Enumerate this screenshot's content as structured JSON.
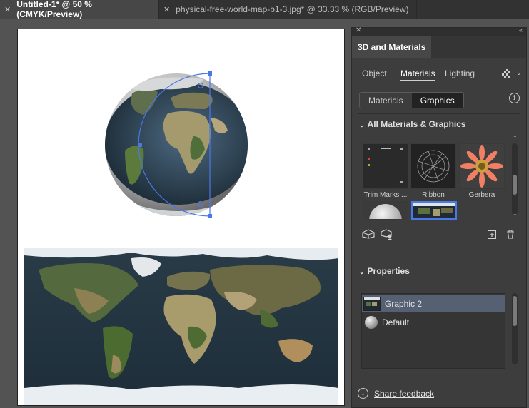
{
  "tabs": [
    {
      "label": "Untitled-1* @ 50 % (CMYK/Preview)",
      "active": true
    },
    {
      "label": "physical-free-world-map-b1-3.jpg* @ 33.33 % (RGB/Preview)",
      "active": false
    }
  ],
  "panel": {
    "title": "3D and Materials",
    "tabs": [
      "Object",
      "Materials",
      "Lighting"
    ],
    "selected_tab": "Materials",
    "segments": [
      "Materials",
      "Graphics"
    ],
    "selected_segment": "Graphics",
    "library_header": "All Materials & Graphics",
    "thumbs": [
      {
        "label": "Trim Marks ..."
      },
      {
        "label": "Ribbon"
      },
      {
        "label": "Gerbera"
      }
    ],
    "properties_header": "Properties",
    "properties_items": [
      {
        "label": "Graphic 2",
        "selected": true
      },
      {
        "label": "Default",
        "selected": false
      }
    ],
    "feedback_label": "Share feedback"
  },
  "colors": {
    "accent": "#4a78e6",
    "selection_row": "#566073",
    "panel_bg": "#3d3d3d",
    "canvas_bg": "#535353"
  }
}
